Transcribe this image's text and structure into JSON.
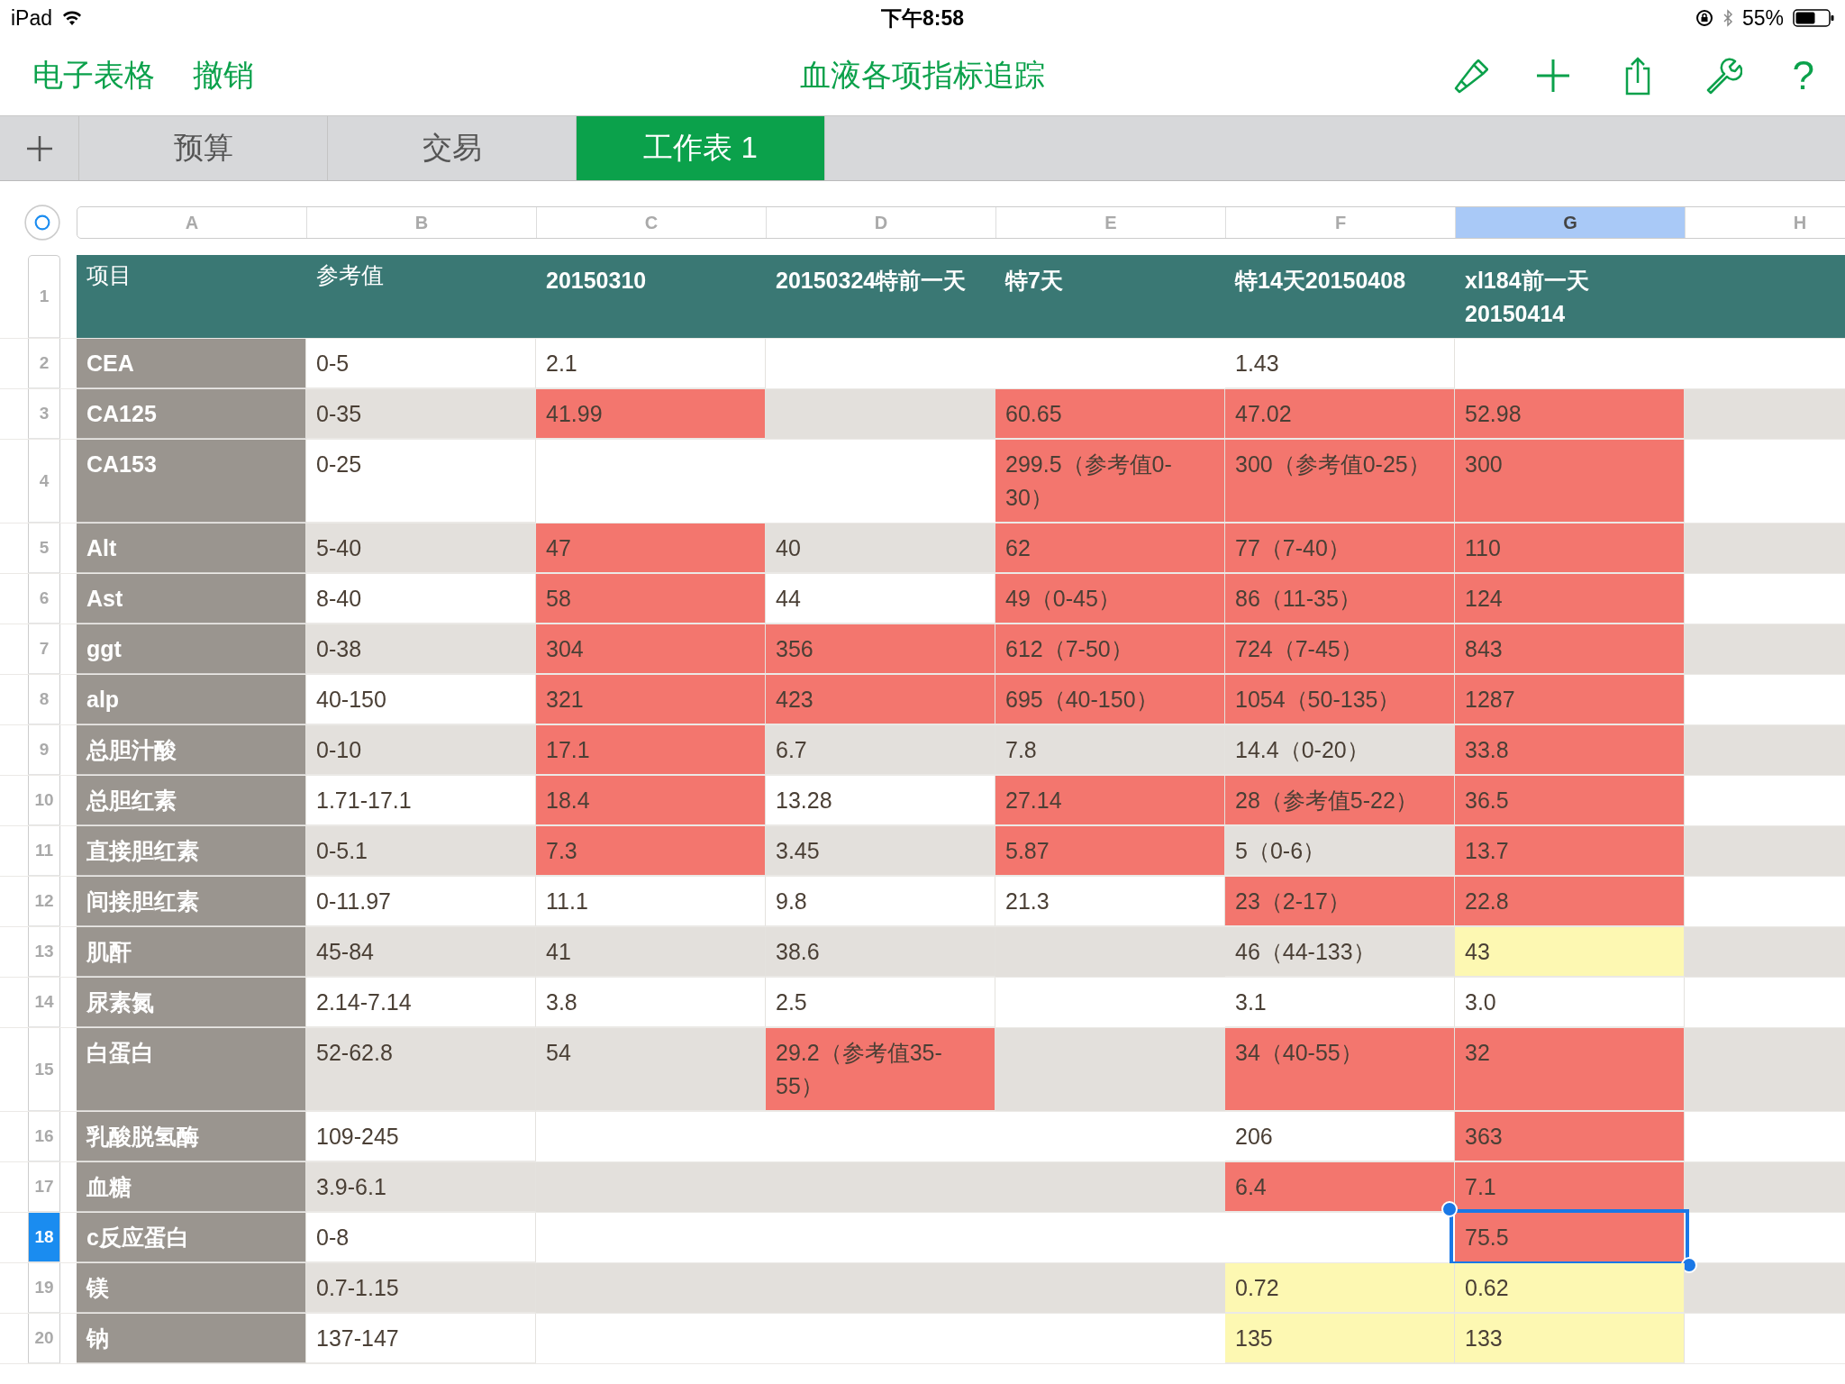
{
  "status_bar": {
    "device": "iPad",
    "time": "下午8:58",
    "battery": "55%"
  },
  "toolbar": {
    "left": [
      "电子表格",
      "撤销"
    ],
    "title": "血液各项指标追踪",
    "help": "?"
  },
  "sheet_tabs": [
    {
      "label": "预算",
      "selected": false
    },
    {
      "label": "交易",
      "selected": false
    },
    {
      "label": "工作表 1",
      "selected": true
    }
  ],
  "columns": [
    {
      "label": "A",
      "selected": false
    },
    {
      "label": "B",
      "selected": false
    },
    {
      "label": "C",
      "selected": false
    },
    {
      "label": "D",
      "selected": false
    },
    {
      "label": "E",
      "selected": false
    },
    {
      "label": "F",
      "selected": false
    },
    {
      "label": "G",
      "selected": true
    },
    {
      "label": "H",
      "selected": false
    }
  ],
  "header_row": {
    "number": "1",
    "cells": [
      {
        "text": "项目",
        "bold": false
      },
      {
        "text": "参考值",
        "bold": false
      },
      {
        "text": "20150310",
        "bold": true
      },
      {
        "text": "20150324特前一天",
        "bold": true
      },
      {
        "text": "特7天",
        "bold": true
      },
      {
        "text": "特14天20150408",
        "bold": true
      },
      {
        "text": "xl184前一天 20150414",
        "bold": true
      },
      {
        "text": "",
        "bold": false
      }
    ]
  },
  "rows": [
    {
      "number": "2",
      "selected": false,
      "cells": [
        {
          "text": "CEA"
        },
        {
          "text": "0-5"
        },
        {
          "text": "2.1"
        },
        {
          "text": ""
        },
        {
          "text": ""
        },
        {
          "text": "1.43"
        },
        {
          "text": ""
        },
        {
          "text": ""
        }
      ]
    },
    {
      "number": "3",
      "selected": false,
      "cells": [
        {
          "text": "CA125"
        },
        {
          "text": "0-35"
        },
        {
          "text": "41.99",
          "color": "#f3766e"
        },
        {
          "text": ""
        },
        {
          "text": "60.65",
          "color": "#f3766e"
        },
        {
          "text": "47.02",
          "color": "#f3766e"
        },
        {
          "text": "52.98",
          "color": "#f3766e"
        },
        {
          "text": ""
        }
      ]
    },
    {
      "number": "4",
      "selected": false,
      "cells": [
        {
          "text": "CA153"
        },
        {
          "text": "0-25"
        },
        {
          "text": ""
        },
        {
          "text": ""
        },
        {
          "text": "299.5（参考值0-30）",
          "color": "#f3766e"
        },
        {
          "text": "300（参考值0-25）",
          "color": "#f3766e"
        },
        {
          "text": "300",
          "color": "#f3766e"
        },
        {
          "text": ""
        }
      ]
    },
    {
      "number": "5",
      "selected": false,
      "cells": [
        {
          "text": "Alt"
        },
        {
          "text": "5-40"
        },
        {
          "text": "47",
          "color": "#f3766e"
        },
        {
          "text": "40"
        },
        {
          "text": "62",
          "color": "#f3766e"
        },
        {
          "text": "77（7-40）",
          "color": "#f3766e"
        },
        {
          "text": "110",
          "color": "#f3766e"
        },
        {
          "text": ""
        }
      ]
    },
    {
      "number": "6",
      "selected": false,
      "cells": [
        {
          "text": "Ast"
        },
        {
          "text": "8-40"
        },
        {
          "text": "58",
          "color": "#f3766e"
        },
        {
          "text": "44"
        },
        {
          "text": "49（0-45）",
          "color": "#f3766e"
        },
        {
          "text": "86（11-35）",
          "color": "#f3766e"
        },
        {
          "text": "124",
          "color": "#f3766e"
        },
        {
          "text": ""
        }
      ]
    },
    {
      "number": "7",
      "selected": false,
      "cells": [
        {
          "text": "ggt"
        },
        {
          "text": "0-38"
        },
        {
          "text": "304",
          "color": "#f3766e"
        },
        {
          "text": "356",
          "color": "#f3766e"
        },
        {
          "text": "612（7-50）",
          "color": "#f3766e"
        },
        {
          "text": "724（7-45）",
          "color": "#f3766e"
        },
        {
          "text": "843",
          "color": "#f3766e"
        },
        {
          "text": ""
        }
      ]
    },
    {
      "number": "8",
      "selected": false,
      "cells": [
        {
          "text": "alp"
        },
        {
          "text": "40-150"
        },
        {
          "text": "321",
          "color": "#f3766e"
        },
        {
          "text": "423",
          "color": "#f3766e"
        },
        {
          "text": "695（40-150）",
          "color": "#f3766e"
        },
        {
          "text": "1054（50-135）",
          "color": "#f3766e"
        },
        {
          "text": "1287",
          "color": "#f3766e"
        },
        {
          "text": ""
        }
      ]
    },
    {
      "number": "9",
      "selected": false,
      "cells": [
        {
          "text": "总胆汁酸"
        },
        {
          "text": "0-10"
        },
        {
          "text": "17.1",
          "color": "#f3766e"
        },
        {
          "text": "6.7"
        },
        {
          "text": "7.8"
        },
        {
          "text": "14.4（0-20）"
        },
        {
          "text": "33.8",
          "color": "#f3766e"
        },
        {
          "text": ""
        }
      ]
    },
    {
      "number": "10",
      "selected": false,
      "cells": [
        {
          "text": "总胆红素"
        },
        {
          "text": "1.71-17.1"
        },
        {
          "text": "18.4",
          "color": "#f3766e"
        },
        {
          "text": "13.28"
        },
        {
          "text": "27.14",
          "color": "#f3766e"
        },
        {
          "text": "28（参考值5-22）",
          "color": "#f3766e"
        },
        {
          "text": "36.5",
          "color": "#f3766e"
        },
        {
          "text": ""
        }
      ]
    },
    {
      "number": "11",
      "selected": false,
      "cells": [
        {
          "text": "直接胆红素"
        },
        {
          "text": "0-5.1"
        },
        {
          "text": "7.3",
          "color": "#f3766e"
        },
        {
          "text": "3.45"
        },
        {
          "text": "5.87",
          "color": "#f3766e"
        },
        {
          "text": "5（0-6）"
        },
        {
          "text": "13.7",
          "color": "#f3766e"
        },
        {
          "text": ""
        }
      ]
    },
    {
      "number": "12",
      "selected": false,
      "cells": [
        {
          "text": "间接胆红素"
        },
        {
          "text": "0-11.97"
        },
        {
          "text": "11.1"
        },
        {
          "text": "9.8"
        },
        {
          "text": "21.3"
        },
        {
          "text": "23（2-17）",
          "color": "#f3766e"
        },
        {
          "text": "22.8",
          "color": "#f3766e"
        },
        {
          "text": ""
        }
      ]
    },
    {
      "number": "13",
      "selected": false,
      "cells": [
        {
          "text": "肌酐"
        },
        {
          "text": "45-84"
        },
        {
          "text": "41"
        },
        {
          "text": "38.6"
        },
        {
          "text": ""
        },
        {
          "text": "46（44-133）"
        },
        {
          "text": "43",
          "color": "#fdf8b2"
        },
        {
          "text": ""
        }
      ]
    },
    {
      "number": "14",
      "selected": false,
      "cells": [
        {
          "text": "尿素氮"
        },
        {
          "text": "2.14-7.14"
        },
        {
          "text": "3.8"
        },
        {
          "text": "2.5"
        },
        {
          "text": ""
        },
        {
          "text": "3.1"
        },
        {
          "text": "3.0"
        },
        {
          "text": ""
        }
      ]
    },
    {
      "number": "15",
      "selected": false,
      "cells": [
        {
          "text": "白蛋白"
        },
        {
          "text": "52-62.8"
        },
        {
          "text": "54"
        },
        {
          "text": "29.2（参考值35-55）",
          "color": "#f3766e"
        },
        {
          "text": ""
        },
        {
          "text": "34（40-55）",
          "color": "#f3766e"
        },
        {
          "text": "32",
          "color": "#f3766e"
        },
        {
          "text": ""
        }
      ]
    },
    {
      "number": "16",
      "selected": false,
      "cells": [
        {
          "text": "乳酸脱氢酶"
        },
        {
          "text": "109-245"
        },
        {
          "text": ""
        },
        {
          "text": ""
        },
        {
          "text": ""
        },
        {
          "text": "206"
        },
        {
          "text": "363",
          "color": "#f3766e"
        },
        {
          "text": ""
        }
      ]
    },
    {
      "number": "17",
      "selected": false,
      "cells": [
        {
          "text": "血糖"
        },
        {
          "text": "3.9-6.1"
        },
        {
          "text": ""
        },
        {
          "text": ""
        },
        {
          "text": ""
        },
        {
          "text": "6.4",
          "color": "#f3766e"
        },
        {
          "text": "7.1",
          "color": "#f3766e"
        },
        {
          "text": ""
        }
      ]
    },
    {
      "number": "18",
      "selected": true,
      "cells": [
        {
          "text": "c反应蛋白"
        },
        {
          "text": "0-8"
        },
        {
          "text": ""
        },
        {
          "text": ""
        },
        {
          "text": ""
        },
        {
          "text": ""
        },
        {
          "text": "75.5",
          "color": "#f3766e"
        },
        {
          "text": ""
        }
      ]
    },
    {
      "number": "19",
      "selected": false,
      "cells": [
        {
          "text": "镁"
        },
        {
          "text": "0.7-1.15"
        },
        {
          "text": ""
        },
        {
          "text": ""
        },
        {
          "text": ""
        },
        {
          "text": "0.72",
          "color": "#fdf8b2"
        },
        {
          "text": "0.62",
          "color": "#fdf8b2"
        },
        {
          "text": ""
        }
      ]
    },
    {
      "number": "20",
      "selected": false,
      "cells": [
        {
          "text": "钠"
        },
        {
          "text": "137-147"
        },
        {
          "text": ""
        },
        {
          "text": ""
        },
        {
          "text": ""
        },
        {
          "text": "135",
          "color": "#fdf8b2"
        },
        {
          "text": "133",
          "color": "#fdf8b2"
        },
        {
          "text": ""
        }
      ]
    }
  ]
}
